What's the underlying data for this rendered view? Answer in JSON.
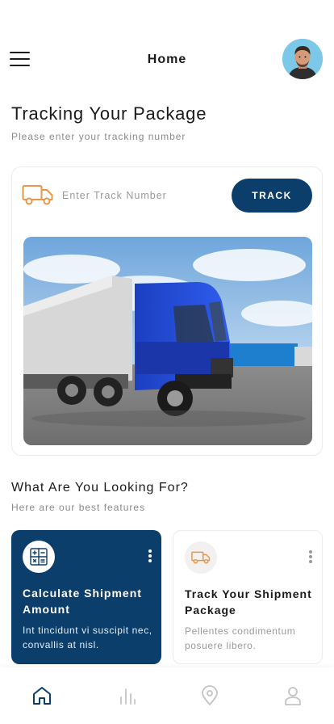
{
  "header": {
    "title": "Home",
    "menu_icon": "hamburger-menu-icon",
    "avatar": "user-avatar"
  },
  "page": {
    "title": "Tracking Your Package",
    "subtitle": "Please enter your tracking number"
  },
  "tracking": {
    "placeholder": "Enter Track Number",
    "value": "",
    "button_label": "TRACK",
    "icon": "truck-icon",
    "image": "blue-truck-photo"
  },
  "features": {
    "title": "What Are You Looking For?",
    "subtitle": "Here are our best features",
    "items": [
      {
        "title": "Calculate Shipment Amount",
        "description": "Int tincidunt vi suscipit nec, convallis at nisl.",
        "icon": "calculator-icon",
        "active": true
      },
      {
        "title": "Track Your Shipment Package",
        "description": "Pellentes condimentum posuere libero.",
        "icon": "truck-icon",
        "active": false
      }
    ]
  },
  "bottom_nav": {
    "items": [
      {
        "icon": "home-icon",
        "active": true
      },
      {
        "icon": "bar-chart-icon",
        "active": false
      },
      {
        "icon": "location-pin-icon",
        "active": false
      },
      {
        "icon": "user-icon",
        "active": false
      }
    ]
  },
  "colors": {
    "primary": "#0c3e6b",
    "accent_orange": "#e8964a",
    "muted_text": "#8a8a8a"
  }
}
